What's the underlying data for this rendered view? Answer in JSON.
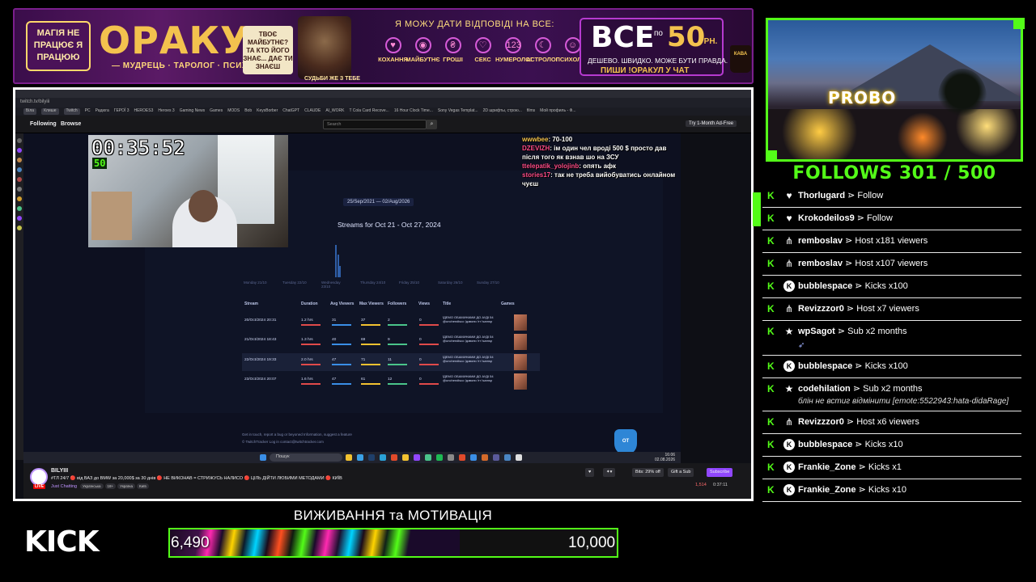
{
  "banner": {
    "badge": "МАГІЯ НЕ ПРАЦЮЄ Я ПРАЦЮЮ",
    "title": "ОРАКУЛ",
    "subtitle": "— МУДРЕЦЬ · ТАРОЛОГ · ПСИХОЛОГ —",
    "future_card": "ТВОЄ МАЙБУТНЄ? ТА КТО ЙОГО ЗНАЄ... ДАЄ ТИ ЗНАЄШ",
    "wizard_tag": "СУДЬБИ ЖЕ З ТЕБЕ",
    "answer": "Я МОЖУ ДАТИ ВІДПОВІДІ НА ВСЕ:",
    "categories": [
      {
        "icon": "♥",
        "label": "КОХАННЯ"
      },
      {
        "icon": "◉",
        "label": "МАЙБУТНЄ"
      },
      {
        "icon": "₴",
        "label": "ГРОШІ"
      },
      {
        "icon": "♡",
        "label": "СЕКС"
      },
      {
        "icon": "123",
        "label": "НУМЕРОЛОГ"
      },
      {
        "icon": "☾",
        "label": "АСТРОЛОГ"
      },
      {
        "icon": "☺",
        "label": "ПСИХОЛОГ"
      }
    ],
    "price_big": "ВСЕ",
    "price_po": "по",
    "price_num": "50",
    "price_grn": "ГРН.",
    "price_small": "ДЕШЕВО. ШВИДКО. МОЖЕ БУТИ ПРАВДА.",
    "price_chat": "ПИШИ !ОРАКУЛ У ЧАТ",
    "mug": "КАВА"
  },
  "browser": {
    "url": "twitch.tv/bilyiii",
    "bookmarks": [
      "Біла",
      "Клише",
      "Twitch",
      "PC",
      "Радюга",
      "ГЕРОЇ 3",
      "HEROES3",
      "Heroes 3",
      "Gaming News",
      "Games",
      "MODS",
      "Bob",
      "KeysBorber",
      "ChatGPT",
      "CLAUDE",
      "AI_WORK",
      "T Cola Card Recove...",
      "16 Hour Clock Time...",
      "Sony Vegas Templat...",
      "2D шрифты, строю...",
      "films",
      "Мой профиль - Ф..."
    ]
  },
  "twitch": {
    "following": "Following",
    "browse": "Browse",
    "search_placeholder": "Search",
    "ad_free": "Try 1-Month Ad-Free",
    "channel": "BILYIII",
    "live": "LIVE",
    "title": "#ТЛ 24/7 🔴 від ВАЗ до BMW за 20,000$ за 30 днів 🔴 НЕ ВИКОНАВ = СТРИЖУСЬ НАЛИСО 🔴 ЦІЛЬ ДІЙТИ ЛЮБИМИ МЕТОДАМИ 🔴 КИЇВ",
    "category": "Just Chatting",
    "tags": [
      "Українська",
      "18+",
      "Україна",
      "Київ"
    ],
    "bits_btn": "Bits: 29% off",
    "gift_btn": "Gift a Sub",
    "subscribe_btn": "Subscribe",
    "viewers": "1,514",
    "uptime": "0:37:11"
  },
  "dashboard": {
    "date_range": "25/Sep/2021 — 02/Aug/2026",
    "streams_title": "Streams for Oct 21 - Oct 27, 2024",
    "days": [
      "Monday 21/10",
      "Tuesday 22/10",
      "Wednesday 23/10",
      "Thursday 24/10",
      "Friday 25/10",
      "Saturday 26/10",
      "Sunday 27/10"
    ],
    "headers": [
      "Stream",
      "Duration",
      "Avg Viewers",
      "Max Viewers",
      "Followers",
      "Views",
      "Title",
      "Games"
    ],
    "rows": [
      {
        "stream": "20/Oct/2024 20:31",
        "duration": "1.2 hrs",
        "avg": "31",
        "max": "37",
        "followers": "2",
        "views": "0",
        "title": "ЇДЕМО ОБАМИНАМИ ДО АУДІ 54 @unchendisco !дзвони !тг !samsp"
      },
      {
        "stream": "21/Oct/2024 18:43",
        "duration": "1.3 hrs",
        "avg": "40",
        "max": "69",
        "followers": "9",
        "views": "0",
        "title": "ЇДЕМО ОБАМИНАМИ ДО АУДІ 54 @unchendisco !дзвони !тг !samsp"
      },
      {
        "stream": "22/Oct/2024 19:33",
        "duration": "2.0 hrs",
        "avg": "47",
        "max": "71",
        "followers": "11",
        "views": "0",
        "title": "ЇДЕМО ОБАМИНАМИ ДО АУДІ 54 @unchendisco !дзвони !тг !samsp"
      },
      {
        "stream": "23/Oct/2024 20:07",
        "duration": "1.6 hrs",
        "avg": "47",
        "max": "61",
        "followers": "12",
        "views": "0",
        "title": "ЇДЕМО ОБАМИНАМИ ДО АУДІ 54 @unchendisco !дзвони !тг !samsp"
      }
    ],
    "footer1": "Get in touch, report a bug or beyoned Information, suggest a feature",
    "footer2": "© TwitchTracker   Log in   contact@twitchtracker.com",
    "owl": "OT"
  },
  "overlay": {
    "timer": "00:35:52",
    "timer_sub": "50",
    "chat": [
      {
        "user": "wwwbee",
        "text": ": 70-100"
      },
      {
        "user": "DZEVIZH",
        "text": ": ім один чел вроді 500 $ просто дав після того як взнав шо на ЗСУ"
      },
      {
        "user": "ttelepatik_yolojinb",
        "text": ": опять афк"
      },
      {
        "user": "stories17",
        "text": ": так не треба вийобуватись онлайном чуєш"
      }
    ]
  },
  "taskbar": {
    "search": "Пошук",
    "time": "16:06",
    "date": "02.08.2026"
  },
  "goal": {
    "kick_logo": "KICK",
    "title": "ВИЖИВАННЯ та МОТИВАЦІЯ",
    "current": "6,490",
    "max": "10,000",
    "fraction": 0.649
  },
  "follows": {
    "label": "FOLLOWS 301 / 500"
  },
  "mini_player": {
    "sign": "PROBO"
  },
  "events": [
    {
      "icon": "heart",
      "user": "Thorlugard",
      "action": " ⋗ Follow"
    },
    {
      "icon": "host",
      "user": "Krokodeilos9",
      "action": " ⋗ Follow",
      "heart": true
    },
    {
      "icon": "host",
      "user": "remboslav",
      "action": " ⋗ Host x181 viewers"
    },
    {
      "icon": "host",
      "user": "remboslav",
      "action": " ⋗ Host x107 viewers"
    },
    {
      "icon": "kick",
      "user": "bubblespace",
      "action": " ⋗ Kicks x100"
    },
    {
      "icon": "host",
      "user": "Revizzzor0",
      "action": " ⋗ Host x7 viewers"
    },
    {
      "icon": "star",
      "user": "wpSagot",
      "action": " ⋗ Sub x2 months",
      "emote": true
    },
    {
      "icon": "kick",
      "user": "bubblespace",
      "action": " ⋗ Kicks x100"
    },
    {
      "icon": "star",
      "user": "codehilation",
      "action": " ⋗ Sub x2 months",
      "msg": "блін не встиг відмінити [emote:5522943:hata-didaRage]"
    },
    {
      "icon": "host",
      "user": "Revizzzor0",
      "action": " ⋗ Host x6 viewers"
    },
    {
      "icon": "kick",
      "user": "bubblespace",
      "action": " ⋗ Kicks x10"
    },
    {
      "icon": "kick",
      "user": "Frankie_Zone",
      "action": " ⋗ Kicks x1"
    },
    {
      "icon": "kick",
      "user": "Frankie_Zone",
      "action": " ⋗ Kicks x10"
    }
  ]
}
